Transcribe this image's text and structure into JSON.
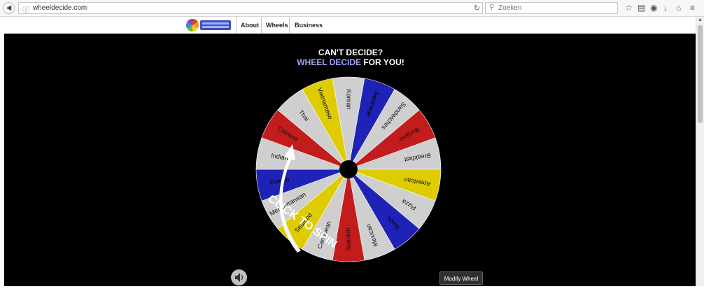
{
  "browser": {
    "url": "wheeldecide.com",
    "search_placeholder": "Zoeken"
  },
  "nav": {
    "logo_text": "WHEEL DECIDE",
    "links": [
      "About",
      "Wheels",
      "Business"
    ]
  },
  "main": {
    "heading_line1": "CAN'T DECIDE?",
    "heading_accent": "WHEEL DECIDE",
    "heading_rest": " FOR YOU!",
    "spin_label": "CLICK TO SPIN",
    "modify_button": "Modify Wheel"
  },
  "wheel": {
    "colors": {
      "yellow": "#dfcc00",
      "blue": "#1f22b6",
      "red": "#c31c1c",
      "grey": "#cfcfcf"
    },
    "segments": [
      {
        "label": "Korean",
        "color": "grey"
      },
      {
        "label": "Japanese",
        "color": "blue"
      },
      {
        "label": "Sandwiches",
        "color": "grey"
      },
      {
        "label": "Burgers",
        "color": "red"
      },
      {
        "label": "Breakfast",
        "color": "grey"
      },
      {
        "label": "American",
        "color": "yellow"
      },
      {
        "label": "Pizza",
        "color": "grey"
      },
      {
        "label": "Sushi",
        "color": "blue"
      },
      {
        "label": "Mexican",
        "color": "grey"
      },
      {
        "label": "Spanish",
        "color": "red"
      },
      {
        "label": "Caribbean",
        "color": "grey"
      },
      {
        "label": "Seafood",
        "color": "yellow"
      },
      {
        "label": "Mediterranean",
        "color": "grey"
      },
      {
        "label": "French",
        "color": "blue"
      },
      {
        "label": "Indian",
        "color": "grey"
      },
      {
        "label": "Chinese",
        "color": "red"
      },
      {
        "label": "Thai",
        "color": "grey"
      },
      {
        "label": "Vietnamese",
        "color": "yellow"
      }
    ]
  }
}
